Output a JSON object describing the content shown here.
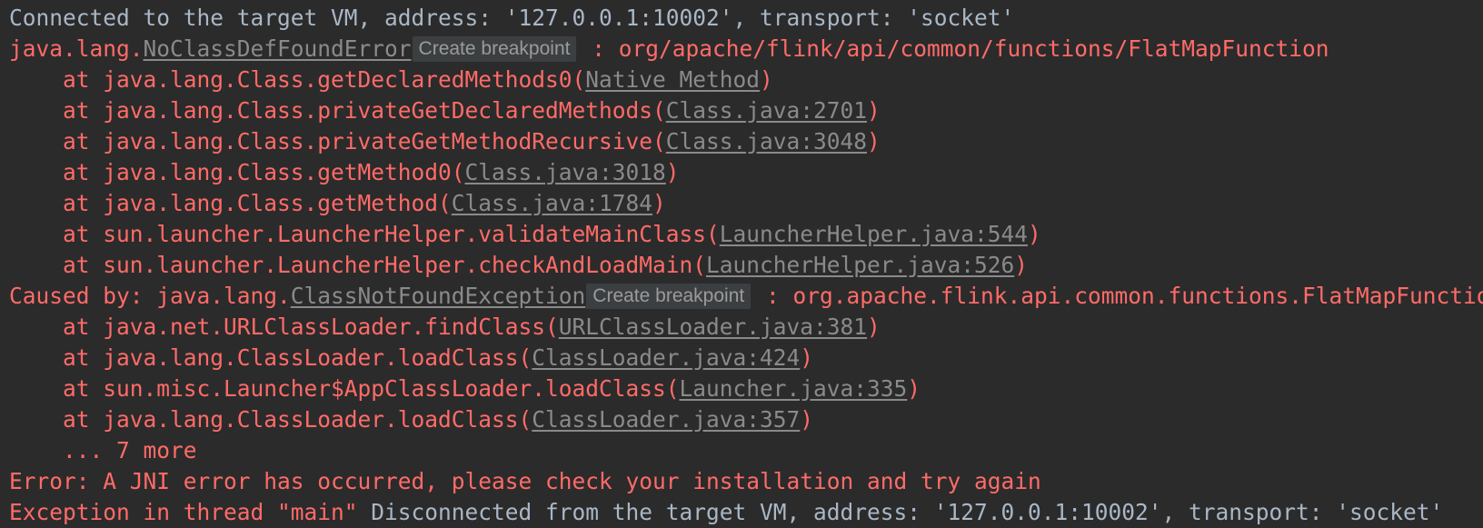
{
  "console": {
    "name": "java-debug-console",
    "background_color": "#2b2b2b",
    "system_text_color": "#a9b7c6",
    "error_text_color": "#ff6b68",
    "link_text_color": "#8a8a8a",
    "badge_background_color": "#3c3f41",
    "badge_label": "Create breakpoint",
    "lines": [
      {
        "id": "line-connected",
        "kind": "system",
        "text": "Connected to the target VM, address: '127.0.0.1:10002', transport: 'socket'"
      },
      {
        "id": "line-exception-header",
        "kind": "exception-header",
        "prefix": "java.lang.",
        "link": "NoClassDefFoundError",
        "badge": "Create breakpoint",
        "suffix": " : org/apache/flink/api/common/functions/FlatMapFunction"
      },
      {
        "id": "line-frame-1",
        "kind": "stack-frame",
        "prefix": "    at java.lang.Class.getDeclaredMethods0(",
        "link": "Native Method",
        "suffix": ")"
      },
      {
        "id": "line-frame-2",
        "kind": "stack-frame",
        "prefix": "    at java.lang.Class.privateGetDeclaredMethods(",
        "link": "Class.java:2701",
        "suffix": ")"
      },
      {
        "id": "line-frame-3",
        "kind": "stack-frame",
        "prefix": "    at java.lang.Class.privateGetMethodRecursive(",
        "link": "Class.java:3048",
        "suffix": ")"
      },
      {
        "id": "line-frame-4",
        "kind": "stack-frame",
        "prefix": "    at java.lang.Class.getMethod0(",
        "link": "Class.java:3018",
        "suffix": ")"
      },
      {
        "id": "line-frame-5",
        "kind": "stack-frame",
        "prefix": "    at java.lang.Class.getMethod(",
        "link": "Class.java:1784",
        "suffix": ")"
      },
      {
        "id": "line-frame-6",
        "kind": "stack-frame",
        "prefix": "    at sun.launcher.LauncherHelper.validateMainClass(",
        "link": "LauncherHelper.java:544",
        "suffix": ")"
      },
      {
        "id": "line-frame-7",
        "kind": "stack-frame",
        "prefix": "    at sun.launcher.LauncherHelper.checkAndLoadMain(",
        "link": "LauncherHelper.java:526",
        "suffix": ")"
      },
      {
        "id": "line-caused-by",
        "kind": "exception-header",
        "prefix": "Caused by: java.lang.",
        "link": "ClassNotFoundException",
        "badge": "Create breakpoint",
        "suffix": " : org.apache.flink.api.common.functions.FlatMapFunction"
      },
      {
        "id": "line-frame-8",
        "kind": "stack-frame",
        "prefix": "    at java.net.URLClassLoader.findClass(",
        "link": "URLClassLoader.java:381",
        "suffix": ")"
      },
      {
        "id": "line-frame-9",
        "kind": "stack-frame",
        "prefix": "    at java.lang.ClassLoader.loadClass(",
        "link": "ClassLoader.java:424",
        "suffix": ")"
      },
      {
        "id": "line-frame-10",
        "kind": "stack-frame",
        "prefix": "    at sun.misc.Launcher$AppClassLoader.loadClass(",
        "link": "Launcher.java:335",
        "suffix": ")"
      },
      {
        "id": "line-frame-11",
        "kind": "stack-frame",
        "prefix": "    at java.lang.ClassLoader.loadClass(",
        "link": "ClassLoader.java:357",
        "suffix": ")"
      },
      {
        "id": "line-more",
        "kind": "error",
        "text": "    ... 7 more"
      },
      {
        "id": "line-jni-error",
        "kind": "error",
        "text": "Error: A JNI error has occurred, please check your installation and try again"
      },
      {
        "id": "line-exception-main",
        "kind": "mixed",
        "error_part": "Exception in thread \"main\" ",
        "system_part": "Disconnected from the target VM, address: '127.0.0.1:10002', transport: 'socket'"
      }
    ]
  }
}
